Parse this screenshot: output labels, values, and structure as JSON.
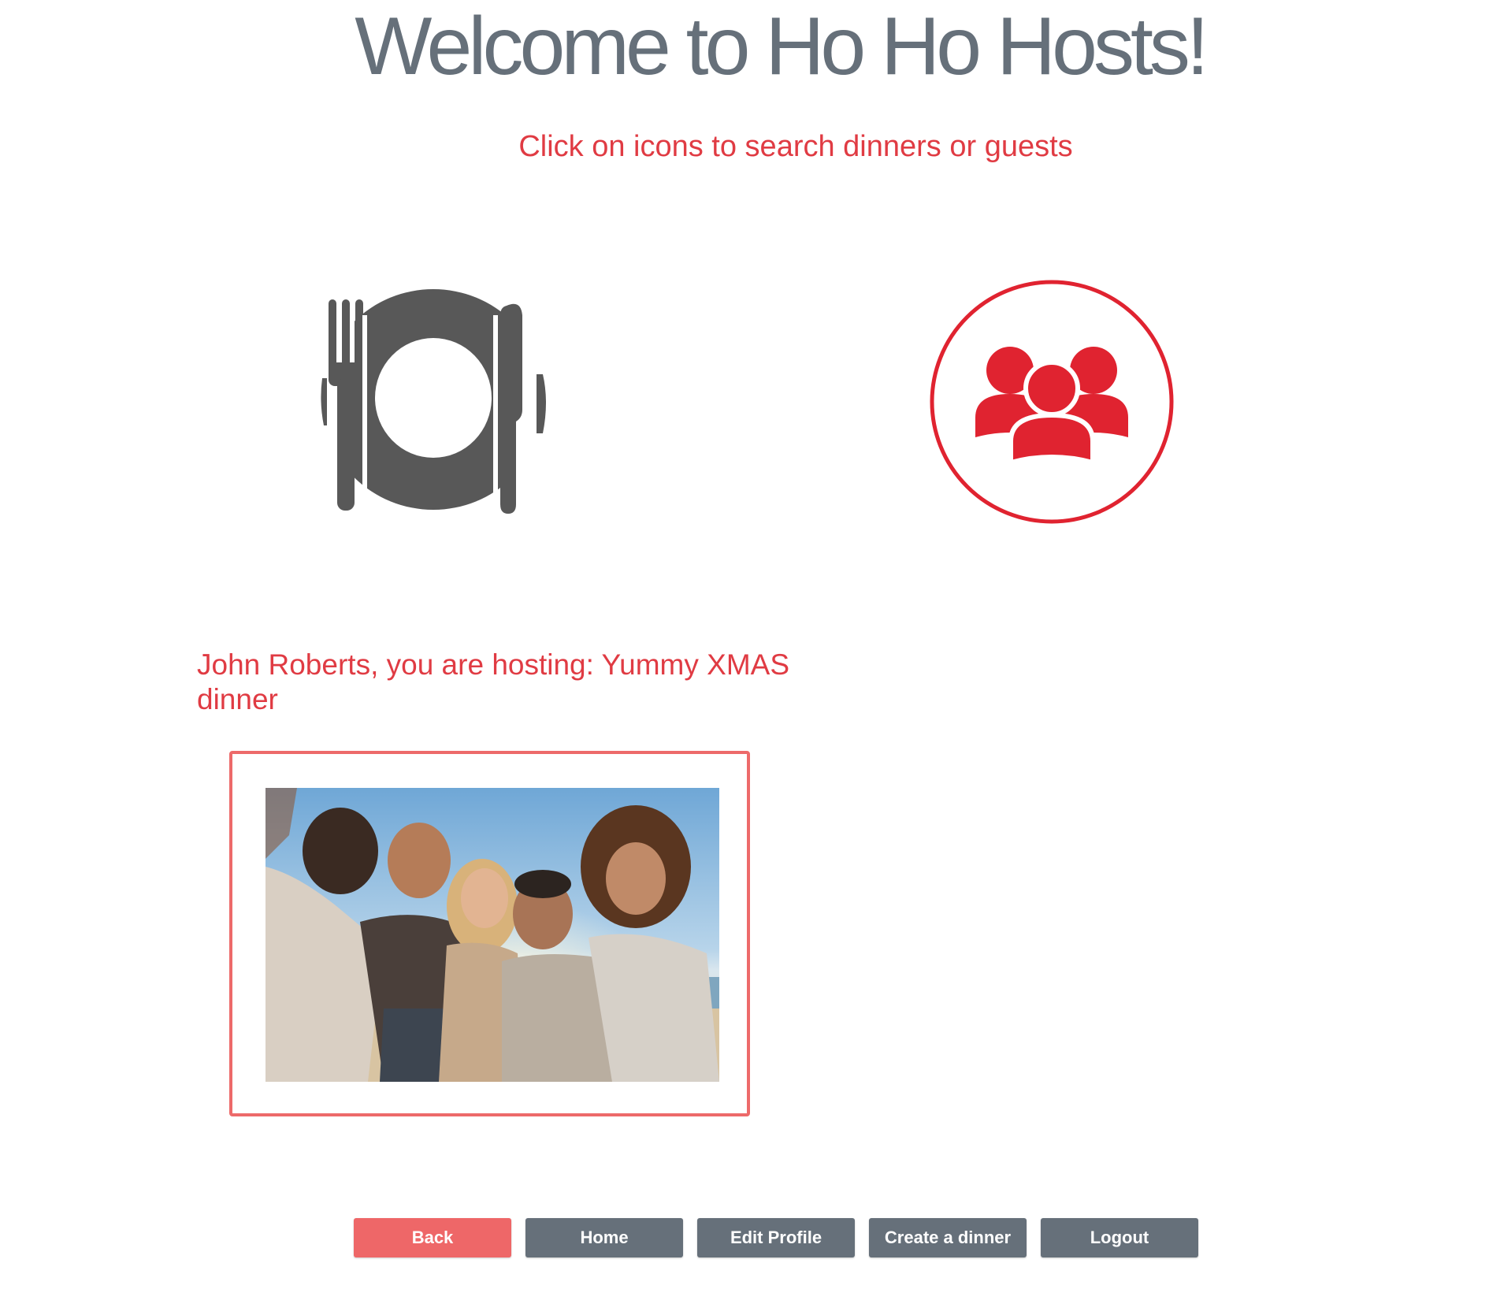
{
  "header": {
    "title": "Welcome to Ho Ho Hosts!",
    "subtitle": "Click on icons to search dinners or guests"
  },
  "icons": {
    "dinners": "plate-fork-knife-icon",
    "guests": "group-people-icon"
  },
  "hosting": {
    "text": "John Roberts, you are hosting: Yummy XMAS dinner"
  },
  "nav": {
    "back": "Back",
    "home": "Home",
    "edit_profile": "Edit Profile",
    "create_dinner": "Create a dinner",
    "logout": "Logout"
  },
  "colors": {
    "accent_red": "#e03b43",
    "button_gray": "#66707a",
    "button_back": "#ee6768",
    "icon_gray": "#585858"
  }
}
